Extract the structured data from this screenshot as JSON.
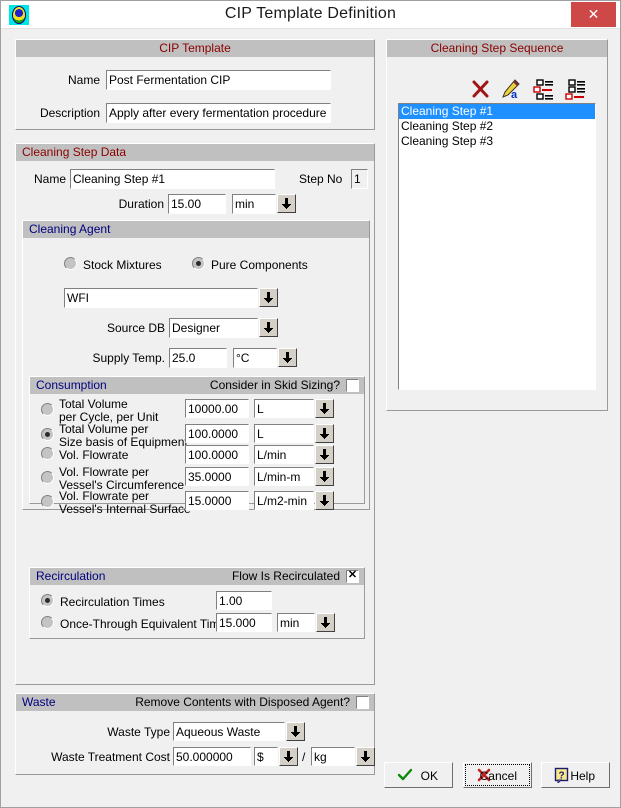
{
  "window": {
    "title": "CIP Template Definition",
    "app_icon": "app-logo-icon",
    "close_label": "✕"
  },
  "cip_template": {
    "header": "CIP Template",
    "name_label": "Name",
    "name_value": "Post Fermentation CIP",
    "description_label": "Description",
    "description_value": "Apply after every fermentation procedure"
  },
  "sequence": {
    "header": "Cleaning Step Sequence",
    "toolbar": [
      {
        "name": "delete-step-icon",
        "title": "Delete"
      },
      {
        "name": "rename-step-icon",
        "title": "Rename"
      },
      {
        "name": "move-step-up-icon",
        "title": "Move Up"
      },
      {
        "name": "move-step-down-icon",
        "title": "Move Down"
      }
    ],
    "items": [
      {
        "label": "Cleaning Step #1",
        "selected": true
      },
      {
        "label": "Cleaning Step #2",
        "selected": false
      },
      {
        "label": "Cleaning Step #3",
        "selected": false
      }
    ]
  },
  "step_data": {
    "header": "Cleaning Step Data",
    "name_label": "Name",
    "name_value": "Cleaning Step #1",
    "step_no_label": "Step No",
    "step_no_value": "1",
    "duration_label": "Duration",
    "duration_value": "15.00",
    "duration_unit": "min"
  },
  "cleaning_agent": {
    "header": "Cleaning Agent",
    "stock_mixtures_label": "Stock Mixtures",
    "stock_mixtures_selected": false,
    "pure_components_label": "Pure Components",
    "pure_components_selected": true,
    "agent_value": "WFI",
    "source_db_label": "Source DB",
    "source_db_value": "Designer",
    "supply_temp_label": "Supply Temp.",
    "supply_temp_value": "25.0",
    "supply_temp_unit": "°C"
  },
  "consumption": {
    "header": "Consumption",
    "skid_label": "Consider in Skid Sizing?",
    "skid_checked": false,
    "rows": [
      {
        "label_line1": "Total Volume",
        "label_line2": "per Cycle, per Unit",
        "selected": false,
        "value": "10000.00",
        "unit": "L"
      },
      {
        "label_line1": "Total Volume per",
        "label_line2": "Size basis of Equipment",
        "selected": true,
        "value": "100.0000",
        "unit": "L"
      },
      {
        "label_line1": "Vol. Flowrate",
        "label_line2": "",
        "selected": false,
        "value": "100.0000",
        "unit": "L/min"
      },
      {
        "label_line1": "Vol. Flowrate per",
        "label_line2": "Vessel's Circumference",
        "selected": false,
        "value": "35.0000",
        "unit": "L/min-m"
      },
      {
        "label_line1": "Vol. Flowrate per",
        "label_line2": "Vessel's Internal Surface",
        "selected": false,
        "value": "15.0000",
        "unit": "L/m2-min"
      }
    ]
  },
  "recirculation": {
    "header": "Recirculation",
    "flow_label": "Flow Is Recirculated",
    "flow_checked": true,
    "times_label": "Recirculation Times",
    "times_selected": true,
    "times_value": "1.00",
    "once_label": "Once-Through Equivalent Time",
    "once_selected": false,
    "once_value": "15.000",
    "once_unit": "min"
  },
  "waste": {
    "header": "Waste",
    "remove_label": "Remove Contents with Disposed Agent?",
    "remove_checked": false,
    "type_label": "Waste Type",
    "type_value": "Aqueous Waste",
    "cost_label": "Waste Treatment Cost",
    "cost_value": "50.000000",
    "cost_currency": "$",
    "cost_separator": "/",
    "cost_basis": "kg"
  },
  "buttons": {
    "ok": "OK",
    "cancel": "Cancel",
    "help": "Help"
  }
}
